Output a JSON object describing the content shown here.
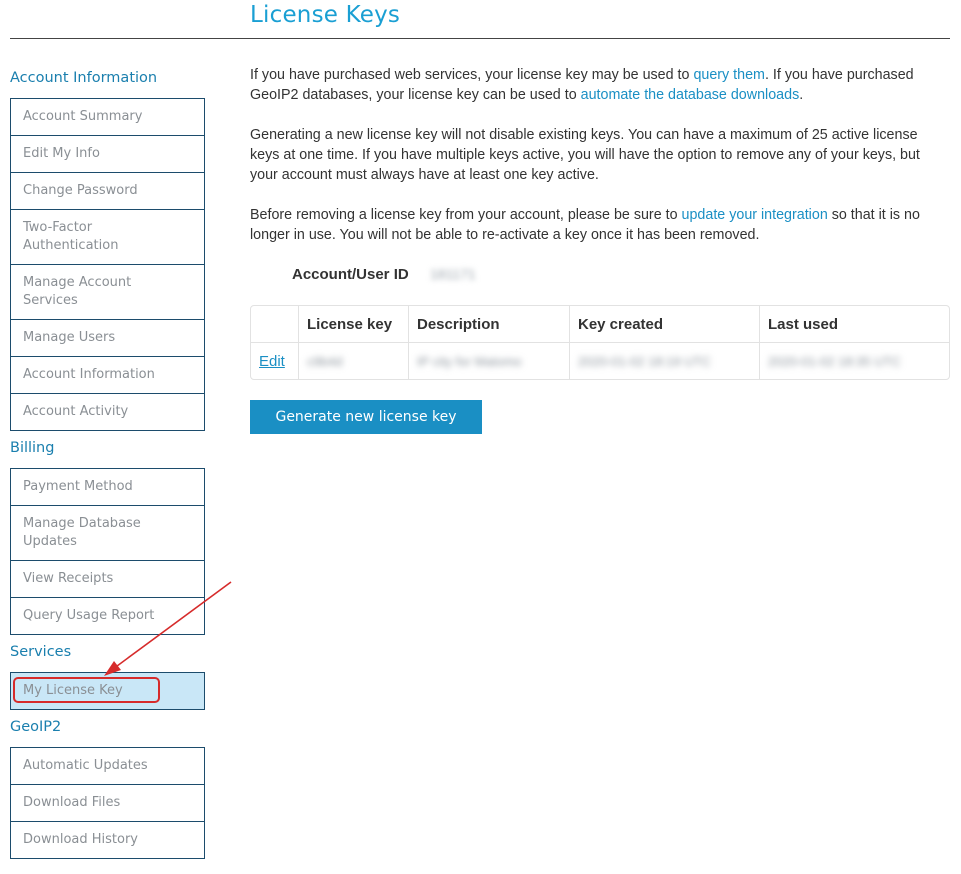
{
  "page": {
    "title": "License Keys"
  },
  "sidebar": {
    "sections": [
      {
        "heading": "Account Information",
        "items": [
          {
            "label": "Account Summary"
          },
          {
            "label": "Edit My Info"
          },
          {
            "label": "Change Password"
          },
          {
            "label": "Two-Factor Authentication"
          },
          {
            "label": "Manage Account Services"
          },
          {
            "label": "Manage Users"
          },
          {
            "label": "Account Information"
          },
          {
            "label": "Account Activity"
          }
        ]
      },
      {
        "heading": "Billing",
        "items": [
          {
            "label": "Payment Method"
          },
          {
            "label": "Manage Database Updates"
          },
          {
            "label": "View Receipts"
          },
          {
            "label": "Query Usage Report"
          }
        ]
      },
      {
        "heading": "Services",
        "items": [
          {
            "label": "My License Key",
            "active": true
          }
        ]
      },
      {
        "heading": "GeoIP2",
        "items": [
          {
            "label": "Automatic Updates"
          },
          {
            "label": "Download Files"
          },
          {
            "label": "Download History"
          }
        ]
      }
    ]
  },
  "content": {
    "para1": {
      "before": "If you have purchased web services, your license key may be used to ",
      "link1": "query them",
      "middle": ". If you have purchased GeoIP2 databases, your license key can be used to ",
      "link2": "automate the database downloads",
      "after": "."
    },
    "para2": "Generating a new license key will not disable existing keys. You can have a maximum of 25 active license keys at one time. If you have multiple keys active, you will have the option to remove any of your keys, but your account must always have at least one key active.",
    "para3": {
      "before": "Before removing a license key from your account, please be sure to ",
      "link": "update your integration",
      "after": " so that it is no longer in use. You will not be able to re-activate a key once it has been removed."
    },
    "account_label": "Account/User ID",
    "account_value": "181171",
    "table": {
      "headers": [
        "",
        "License key",
        "Description",
        "Key created",
        "Last used"
      ],
      "rows": [
        {
          "action": "Edit",
          "license_key": "c9b4d",
          "description": "IP city for Matomo",
          "key_created": "2020-01-02 18:19 UTC",
          "last_used": "2020-01-02 18:35 UTC"
        }
      ]
    },
    "generate_button": "Generate new license key"
  },
  "colors": {
    "accent": "#1a9fd3",
    "link": "#1a8fc4",
    "nav_border": "#1c4c6c",
    "active_bg": "#c9e7f7",
    "annotation_red": "#d62b2b"
  }
}
